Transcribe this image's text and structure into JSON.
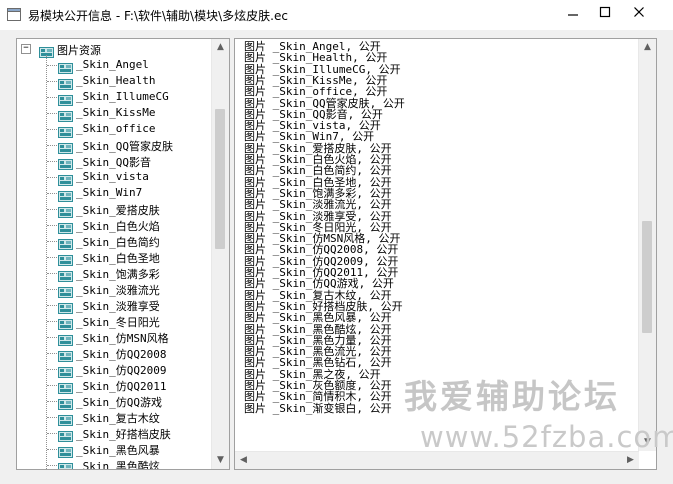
{
  "window": {
    "title": "易模块公开信息 - F:\\软件\\辅助\\模块\\多炫皮肤.ec"
  },
  "tree": {
    "root_label": "图片资源",
    "root_expander": "−",
    "items": [
      "_Skin_Angel",
      "_Skin_Health",
      "_Skin_IllumeCG",
      "_Skin_KissMe",
      "_Skin_office",
      "_Skin_QQ管家皮肤",
      "_Skin_QQ影音",
      "_Skin_vista",
      "_Skin_Win7",
      "_Skin_爱搭皮肤",
      "_Skin_白色火焰",
      "_Skin_白色简约",
      "_Skin_白色圣地",
      "_Skin_饱满多彩",
      "_Skin_淡雅流光",
      "_Skin_淡雅享受",
      "_Skin_冬日阳光",
      "_Skin_仿MSN风格",
      "_Skin_仿QQ2008",
      "_Skin_仿QQ2009",
      "_Skin_仿QQ2011",
      "_Skin_仿QQ游戏",
      "_Skin_复古木纹",
      "_Skin_好搭档皮肤",
      "_Skin_黑色风暴",
      "_Skin_黑色酷炫"
    ]
  },
  "list": {
    "lines": [
      "图片 _Skin_Angel, 公开",
      "图片 _Skin_Health, 公开",
      "图片 _Skin_IllumeCG, 公开",
      "图片 _Skin_KissMe, 公开",
      "图片 _Skin_office, 公开",
      "图片 _Skin_QQ管家皮肤, 公开",
      "图片 _Skin_QQ影音, 公开",
      "图片 _Skin_vista, 公开",
      "图片 _Skin_Win7, 公开",
      "图片 _Skin_爱搭皮肤, 公开",
      "图片 _Skin_白色火焰, 公开",
      "图片 _Skin_白色简约, 公开",
      "图片 _Skin_白色圣地, 公开",
      "图片 _Skin_饱满多彩, 公开",
      "图片 _Skin_淡雅流光, 公开",
      "图片 _Skin_淡雅享受, 公开",
      "图片 _Skin_冬日阳光, 公开",
      "图片 _Skin_仿MSN风格, 公开",
      "图片 _Skin_仿QQ2008, 公开",
      "图片 _Skin_仿QQ2009, 公开",
      "图片 _Skin_仿QQ2011, 公开",
      "图片 _Skin_仿QQ游戏, 公开",
      "图片 _Skin_复古木纹, 公开",
      "图片 _Skin_好搭档皮肤, 公开",
      "图片 _Skin_黑色风暴, 公开",
      "图片 _Skin_黑色酷炫, 公开",
      "图片 _Skin_黑色力量, 公开",
      "图片 _Skin_黑色流光, 公开",
      "图片 _Skin_黑色钻石, 公开",
      "图片 _Skin_黑之夜, 公开",
      "图片 _Skin_灰色额度, 公开",
      "图片 _Skin_简情积木, 公开",
      "图片 _Skin_渐变银白, 公开"
    ]
  },
  "watermark": {
    "line1": "我爱辅助论坛",
    "line2": "www.52fzba.com"
  },
  "icons": {
    "app": "app-window-icon",
    "minimize": "minimize-icon",
    "maximize": "maximize-icon",
    "close": "close-icon",
    "node": "image-folder-icon"
  },
  "colors": {
    "titlebar": "#ffffff",
    "client": "#f0f0f0",
    "panel_border": "#a0a0a0",
    "node_icon_teal": "#2f8f9a",
    "watermark": "#c6c6c6"
  }
}
